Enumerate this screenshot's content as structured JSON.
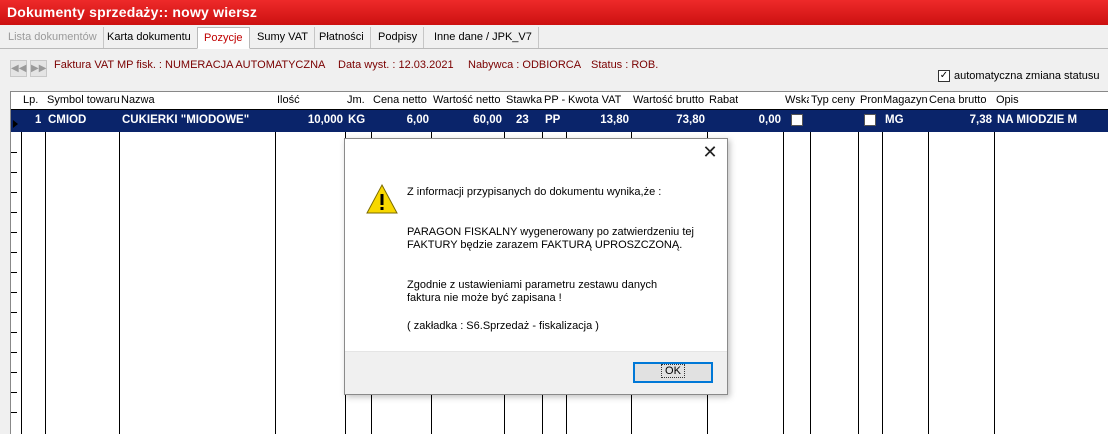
{
  "window": {
    "title": "Dokumenty sprzedaży:: nowy wiersz"
  },
  "tabs": [
    {
      "label": "Lista dokumentów"
    },
    {
      "label": "Karta dokumentu"
    },
    {
      "label": "Pozycje"
    },
    {
      "label": "Sumy VAT"
    },
    {
      "label": "Płatności"
    },
    {
      "label": "Podpisy"
    },
    {
      "label": "Inne dane / JPK_V7"
    }
  ],
  "nav": {
    "first": "◀◀",
    "last": "▶▶",
    "icon_first": "first-record-icon",
    "icon_last": "last-record-icon"
  },
  "info": {
    "doc_type": "Faktura VAT MP fisk. : NUMERACJA AUTOMATYCZNA",
    "date": "Data wyst. : 12.03.2021",
    "buyer": "Nabywca : ODBIORCA",
    "status": "Status : ROB."
  },
  "auto_status": {
    "label": "automatyczna zmiana statusu",
    "checked": true,
    "mark": "✓"
  },
  "grid": {
    "columns": [
      "Lp.",
      "Symbol towaru",
      "Nazwa",
      "Ilość",
      "Jm.",
      "Cena netto",
      "Wartość netto",
      "Stawka",
      "PP -",
      "Kwota VAT",
      "Wartość brutto",
      "Rabat",
      "Wska",
      "Typ ceny",
      "Prom",
      "Magazyn",
      "Cena brutto",
      "Opis"
    ],
    "rows": [
      {
        "lp": "1",
        "symbol": "CMIOD",
        "nazwa": "CUKIERKI \"MIODOWE\"",
        "ilosc": "10,000",
        "jm": "KG",
        "cena_netto": "6,00",
        "wartosc_netto": "60,00",
        "stawka": "23",
        "pp": "PP",
        "kwota_vat": "13,80",
        "wartosc_brutto": "73,80",
        "rabat": "0,00",
        "magazyn": "MG",
        "cena_brutto": "7,38",
        "opis": "NA MIODZIE M"
      }
    ]
  },
  "dialog": {
    "icon": "warning-icon",
    "close": "✕",
    "line1": "Z informacji przypisanych do dokumentu wynika,że :",
    "line2": "PARAGON FISKALNY wygenerowany po zatwierdzeniu tej",
    "line3": "FAKTURY będzie zarazem FAKTURĄ UPROSZCZONĄ.",
    "line4": "Zgodnie z ustawieniami parametru zestawu danych",
    "line5": "faktura nie może być zapisana !",
    "line6": "( zakładka : S6.Sprzedaż - fiskalizacja )",
    "ok": "OK"
  },
  "colors": {
    "title_bar": "#dd1a1a",
    "selection": "#0a246a",
    "info_text": "#7a0000",
    "active_tab": "#c00000"
  }
}
